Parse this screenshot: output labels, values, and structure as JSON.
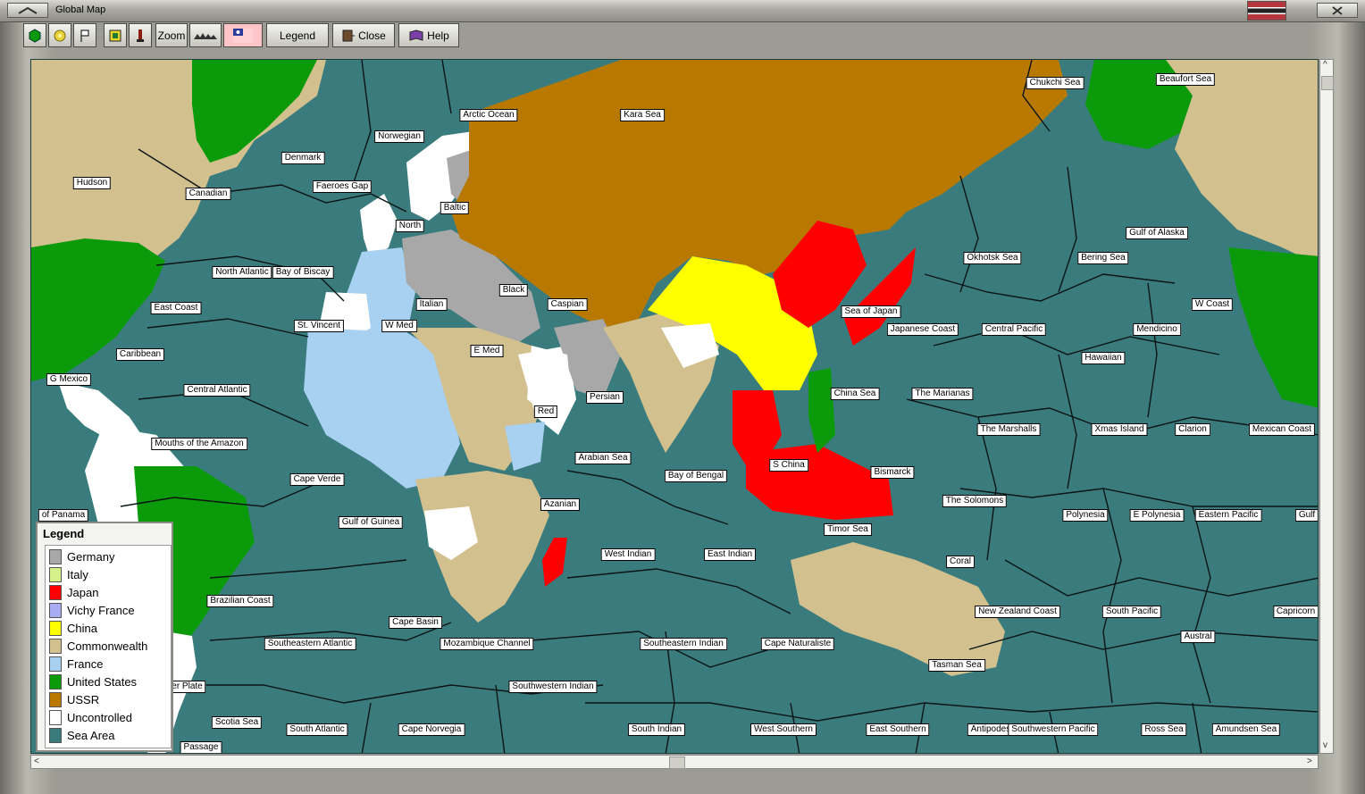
{
  "window": {
    "title": "Global Map"
  },
  "toolbar": {
    "zoom_label": "Zoom",
    "legend_label": "Legend",
    "close_label": "Close",
    "help_label": "Help"
  },
  "legend": {
    "title": "Legend",
    "items": [
      {
        "label": "Germany",
        "color": "#a8a8a8"
      },
      {
        "label": "Italy",
        "color": "#d6f08a"
      },
      {
        "label": "Japan",
        "color": "#ff0000"
      },
      {
        "label": "Vichy France",
        "color": "#a8acf0"
      },
      {
        "label": "China",
        "color": "#ffff00"
      },
      {
        "label": "Commonwealth",
        "color": "#d2c08e"
      },
      {
        "label": "France",
        "color": "#a8d0f0"
      },
      {
        "label": "United States",
        "color": "#0a9a0a"
      },
      {
        "label": "USSR",
        "color": "#b97800"
      },
      {
        "label": "Uncontrolled",
        "color": "#ffffff"
      },
      {
        "label": "Sea Area",
        "color": "#3a7c7e"
      }
    ]
  },
  "colors": {
    "sea": "#3a7c7e",
    "commonwealth": "#d2c08e",
    "us": "#0a9a0a",
    "ussr": "#b97800",
    "japan": "#ff0000",
    "china": "#ffff00",
    "germany": "#a8a8a8",
    "france": "#a8d0f0",
    "uncontrolled": "#ffffff"
  },
  "sea_areas": [
    "Arctic Ocean",
    "Kara Sea",
    "Chukchi Sea",
    "Beaufort Sea",
    "Norwegian",
    "Denmark",
    "Faeroes Gap",
    "Hudson",
    "Canadian",
    "Baltic",
    "North",
    "Gulf of Alaska",
    "Okhotsk Sea",
    "Bering Sea",
    "North Atlantic",
    "Bay of Biscay",
    "Black",
    "Caspian",
    "Italian",
    "Sea of Japan",
    "W Coast",
    "East Coast",
    "St. Vincent",
    "W Med",
    "Japanese Coast",
    "Central Pacific",
    "Mendicino",
    "E Med",
    "Caribbean",
    "Hawaiian",
    "G Mexico",
    "Central Atlantic",
    "China Sea",
    "The Marianas",
    "Persian",
    "Red",
    "Mouths of the Amazon",
    "The Marshalls",
    "Xmas Island",
    "Clarion",
    "Mexican Coast",
    "Arabian Sea",
    "S China",
    "Bismarck",
    "Bay of Bengal",
    "Cape Verde",
    "The Solomons",
    "Azanian",
    "of Panama",
    "Polynesia",
    "E Polynesia",
    "Eastern Pacific",
    "Gulf",
    "Gulf of Guinea",
    "Timor Sea",
    "West Indian",
    "East Indian",
    "Coral",
    "Brazilian Coast",
    "New Zealand Coast",
    "South Pacific",
    "Capricorn",
    "Cape Basin",
    "Austral",
    "Southeastern Atlantic",
    "Mozambique Channel",
    "Southeastern Indian",
    "Cape Naturaliste",
    "Tasman Sea",
    "ver Plate",
    "Southwestern Indian",
    "Scotia Sea",
    "South Atlantic",
    "Cape Norvegia",
    "South Indian",
    "West Southern",
    "East Southern",
    "Antipodes",
    "Southwestern Pacific",
    "Ross Sea",
    "Amundsen Sea",
    "Passage"
  ]
}
